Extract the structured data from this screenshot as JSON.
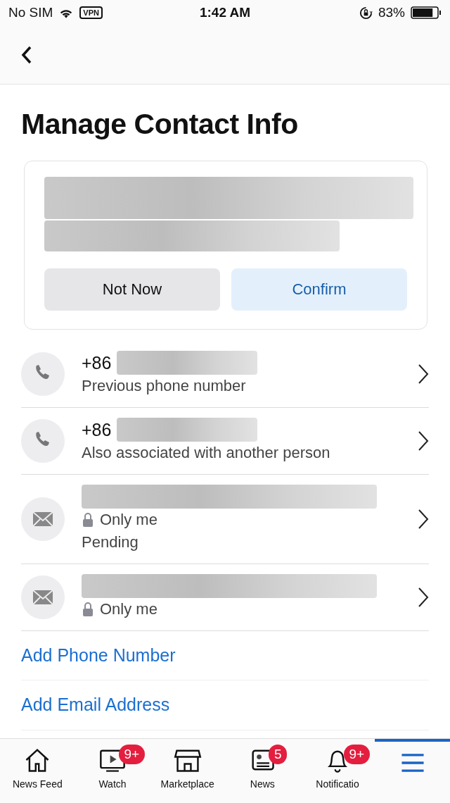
{
  "status_bar": {
    "carrier": "No SIM",
    "vpn": "VPN",
    "time": "1:42 AM",
    "battery_text": "83%",
    "battery": {
      "level": 0.83
    }
  },
  "header": {
    "title": "Manage Contact Info"
  },
  "confirm_card": {
    "buttons": [
      {
        "label": "Not Now",
        "kind": "secondary"
      },
      {
        "label": "Confirm",
        "kind": "primary"
      }
    ]
  },
  "contacts": [
    {
      "kind": "phone",
      "value": "+86",
      "details": [
        {
          "kind": "text",
          "text": "Previous phone number"
        }
      ]
    },
    {
      "kind": "phone",
      "value": "+86",
      "details": [
        {
          "kind": "text",
          "text": "Also associated with another person"
        }
      ]
    },
    {
      "kind": "email",
      "details": [
        {
          "kind": "private",
          "text": "Only me"
        },
        {
          "kind": "text",
          "text": "Pending"
        }
      ]
    },
    {
      "kind": "email",
      "details": [
        {
          "kind": "private",
          "text": "Only me"
        }
      ]
    }
  ],
  "links": [
    "Add Phone Number",
    "Add Email Address"
  ],
  "tab_bar": [
    {
      "kind": "home",
      "label": "News Feed",
      "selected": false
    },
    {
      "kind": "video",
      "label": "Watch",
      "badge": "9+",
      "selected": false
    },
    {
      "kind": "store",
      "label": "Marketplace",
      "selected": false
    },
    {
      "kind": "news",
      "label": "News",
      "badge": "5",
      "selected": false
    },
    {
      "kind": "bell",
      "label": "Notificatio",
      "badge": "9+",
      "selected": false
    },
    {
      "kind": "menu",
      "selected": true
    }
  ]
}
